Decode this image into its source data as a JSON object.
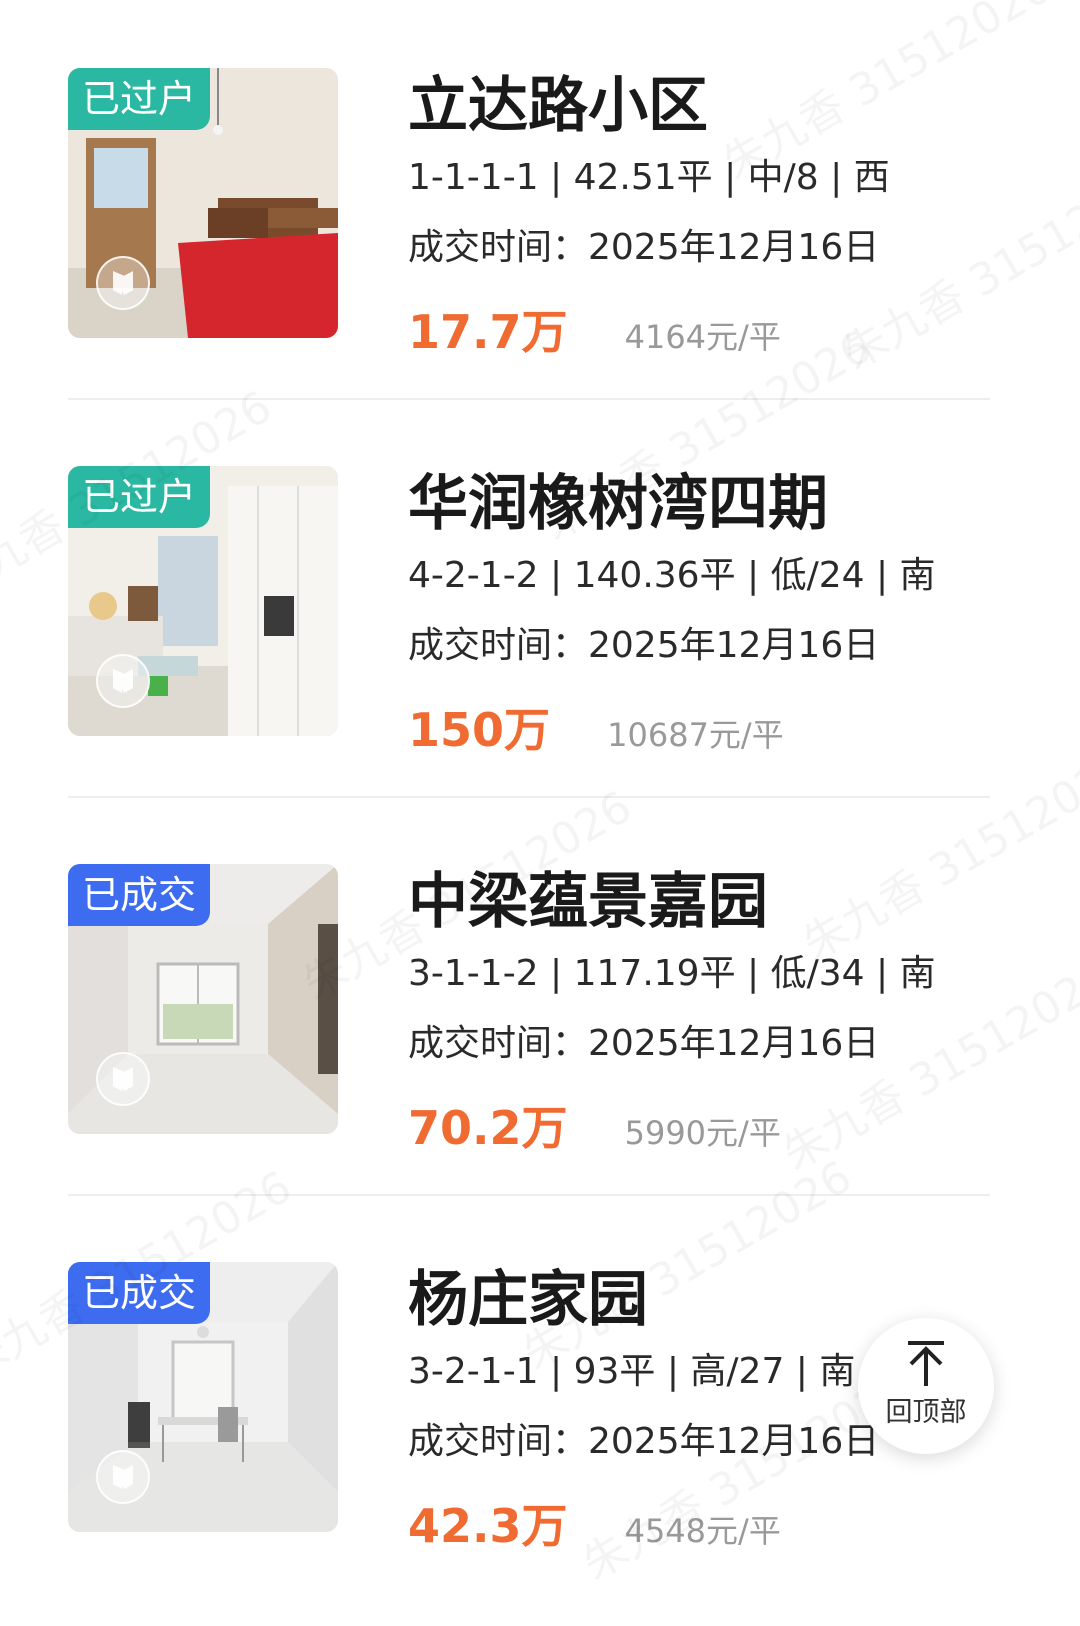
{
  "listings": [
    {
      "badge": "已过户",
      "badge_color": "#2bb8a3",
      "title": "立达路小区",
      "specs": "1-1-1-1 | 42.51平 | 中/8 | 西",
      "deal_time": "成交时间：2025年12月16日",
      "price": "17.7万",
      "unit_price": "4164元/平"
    },
    {
      "badge": "已过户",
      "badge_color": "#2bb8a3",
      "title": "华润橡树湾四期",
      "specs": "4-2-1-2 | 140.36平 | 低/24 | 南",
      "deal_time": "成交时间：2025年12月16日",
      "price": "150万",
      "unit_price": "10687元/平"
    },
    {
      "badge": "已成交",
      "badge_color": "#3d6cf0",
      "title": "中梁蕴景嘉园",
      "specs": "3-1-1-2 | 117.19平 | 低/34 | 南",
      "deal_time": "成交时间：2025年12月16日",
      "price": "70.2万",
      "unit_price": "5990元/平"
    },
    {
      "badge": "已成交",
      "badge_color": "#3d6cf0",
      "title": "杨庄家园",
      "specs": "3-2-1-1 | 93平 | 高/27 | 南",
      "deal_time": "成交时间：2025年12月16日",
      "price": "42.3万",
      "unit_price": "4548元/平"
    }
  ],
  "back_to_top": {
    "label": "回顶部",
    "icon": "arrow-up-to-top-icon"
  },
  "watermark": {
    "text": "朱九香 31512026"
  },
  "colors": {
    "price": "#ef6b32",
    "badge_transferred": "#2bb8a3",
    "badge_sold": "#3d6cf0",
    "unit_price": "#999999"
  }
}
